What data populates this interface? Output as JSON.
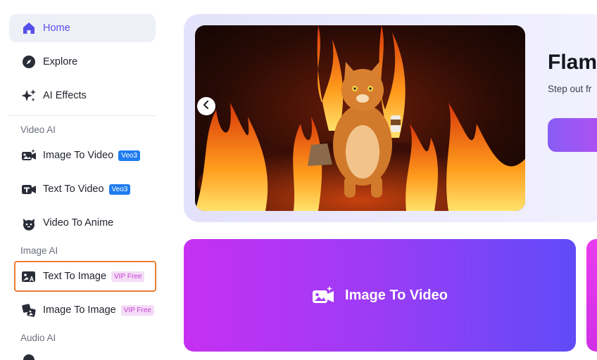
{
  "sidebar": {
    "top_items": [
      {
        "label": "Home",
        "icon": "home-icon"
      },
      {
        "label": "Explore",
        "icon": "compass-icon"
      },
      {
        "label": "AI Effects",
        "icon": "sparkles-icon"
      }
    ],
    "video_section": {
      "title": "Video AI",
      "items": [
        {
          "label": "Image To Video",
          "badge": "Veo3",
          "icon": "image-video-icon"
        },
        {
          "label": "Text To Video",
          "badge": "Veo3",
          "icon": "text-video-icon"
        },
        {
          "label": "Video To Anime",
          "badge": "",
          "icon": "anime-face-icon"
        }
      ]
    },
    "image_section": {
      "title": "Image AI",
      "items": [
        {
          "label": "Text To Image",
          "badge": "VIP Free",
          "icon": "text-image-icon"
        },
        {
          "label": "Image To Image",
          "badge": "VIP Free",
          "icon": "image-image-icon"
        }
      ]
    },
    "audio_section": {
      "title": "Audio AI"
    }
  },
  "hero": {
    "title": "Flam",
    "subtitle": "Step out fr"
  },
  "cards": [
    {
      "label": "Image To Video",
      "icon": "image-video-icon"
    }
  ],
  "colors": {
    "accent": "#5650e8",
    "veo_badge": "#1f7cf0",
    "vip_badge_text": "#c53fd2",
    "highlight_outline": "#ea7d33"
  }
}
